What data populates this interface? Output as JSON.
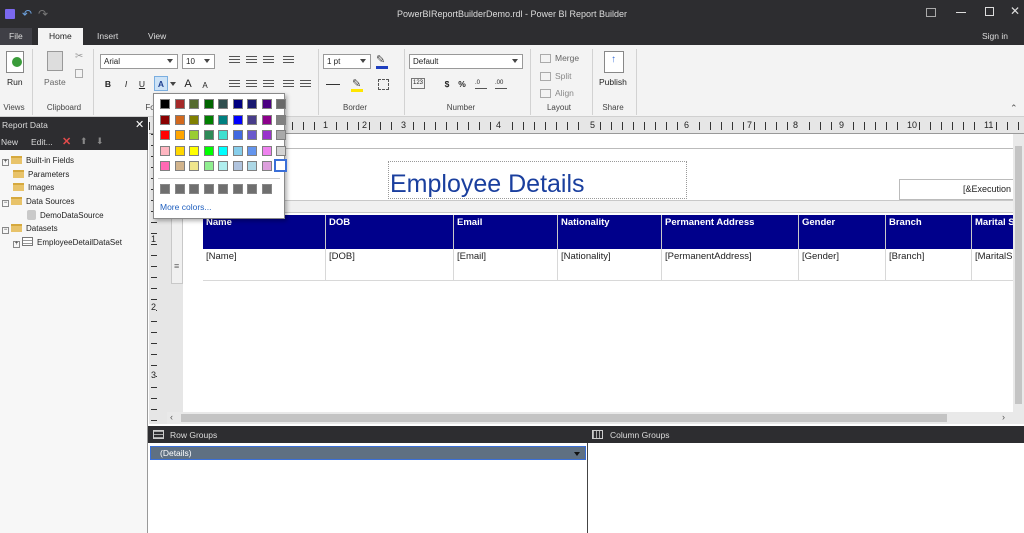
{
  "window": {
    "title": "PowerBIReportBuilderDemo.rdl - Power BI Report Builder"
  },
  "menu": {
    "tabs": [
      "File",
      "Home",
      "Insert",
      "View"
    ],
    "active": "Home",
    "signin": "Sign in"
  },
  "ribbon": {
    "run_label": "Run",
    "paste_label": "Paste",
    "font_name": "Arial",
    "font_size": "10",
    "bold": "B",
    "italic": "I",
    "underline": "U",
    "font_color": "A",
    "grow_font": "A",
    "shrink_font": "A",
    "border_width": "1 pt",
    "number_format": "Default",
    "currency": "$",
    "percent": "%",
    "number_badge": "123",
    "merge_label": "Merge",
    "split_label": "Split",
    "align_label": "Align",
    "publish_label": "Publish",
    "groups": {
      "views": "Views",
      "clipboard": "Clipboard",
      "font": "Fo",
      "border": "Border",
      "number": "Number",
      "layout": "Layout",
      "share": "Share"
    }
  },
  "color_picker": {
    "swatches": [
      [
        "#000000",
        "#a52a2a",
        "#556b2f",
        "#006400",
        "#2f4f4f",
        "#000080",
        "#191970",
        "#4b0082",
        "#696969"
      ],
      [
        "#8b0000",
        "#d2691e",
        "#808000",
        "#008000",
        "#008080",
        "#0000ff",
        "#483d8b",
        "#8b008b",
        "#808080"
      ],
      [
        "#ff0000",
        "#ffa500",
        "#9acd32",
        "#2e8b57",
        "#40e0d0",
        "#4169e1",
        "#6a5acd",
        "#9932cc",
        "#a9a9a9"
      ],
      [
        "#ffb6c1",
        "#ffd700",
        "#ffff00",
        "#00ff00",
        "#00ffff",
        "#87ceeb",
        "#6495ed",
        "#ee82ee",
        "#d3d3d3"
      ],
      [
        "#ff69b4",
        "#d2b48c",
        "#f0e68c",
        "#90ee90",
        "#afeeee",
        "#b0c4de",
        "#add8e6",
        "#dda0dd",
        "#ffffff"
      ]
    ],
    "recent": [
      "#6f6f6f",
      "#6f6f6f",
      "#6f6f6f",
      "#6f6f6f",
      "#6f6f6f",
      "#6f6f6f",
      "#6f6f6f",
      "#6f6f6f"
    ],
    "more_colors": "More colors..."
  },
  "report_data": {
    "title": "Report Data",
    "new_label": "New",
    "edit_label": "Edit...",
    "tree": [
      {
        "label": "Built-in Fields",
        "icon": "folder-icon"
      },
      {
        "label": "Parameters",
        "icon": "folder-icon"
      },
      {
        "label": "Images",
        "icon": "folder-icon"
      },
      {
        "label": "Data Sources",
        "icon": "folder-icon"
      },
      {
        "label": "DemoDataSource",
        "icon": "datasource-icon"
      },
      {
        "label": "Datasets",
        "icon": "folder-icon"
      },
      {
        "label": "EmployeeDetailDataSet",
        "icon": "dataset-icon"
      }
    ]
  },
  "ruler": {
    "numbers": [
      "1",
      "2",
      "3",
      "4",
      "5",
      "6",
      "7",
      "8",
      "9",
      "10",
      "11"
    ],
    "left_numbers": [
      "1",
      "2",
      "3"
    ]
  },
  "report": {
    "title": "Employee Details",
    "execution_field": "[&Execution",
    "headers": [
      "Name",
      "DOB",
      "Email",
      "Nationality",
      "Permanent Address",
      "Gender",
      "Branch",
      "Marital S"
    ],
    "fields": [
      "[Name]",
      "[DOB]",
      "[Email]",
      "[Nationality]",
      "[PermanentAddress]",
      "[Gender]",
      "[Branch]",
      "[MaritalS"
    ],
    "header_color": "#00008b"
  },
  "groups": {
    "row_label": "Row Groups",
    "column_label": "Column Groups",
    "row_details": "(Details)"
  }
}
